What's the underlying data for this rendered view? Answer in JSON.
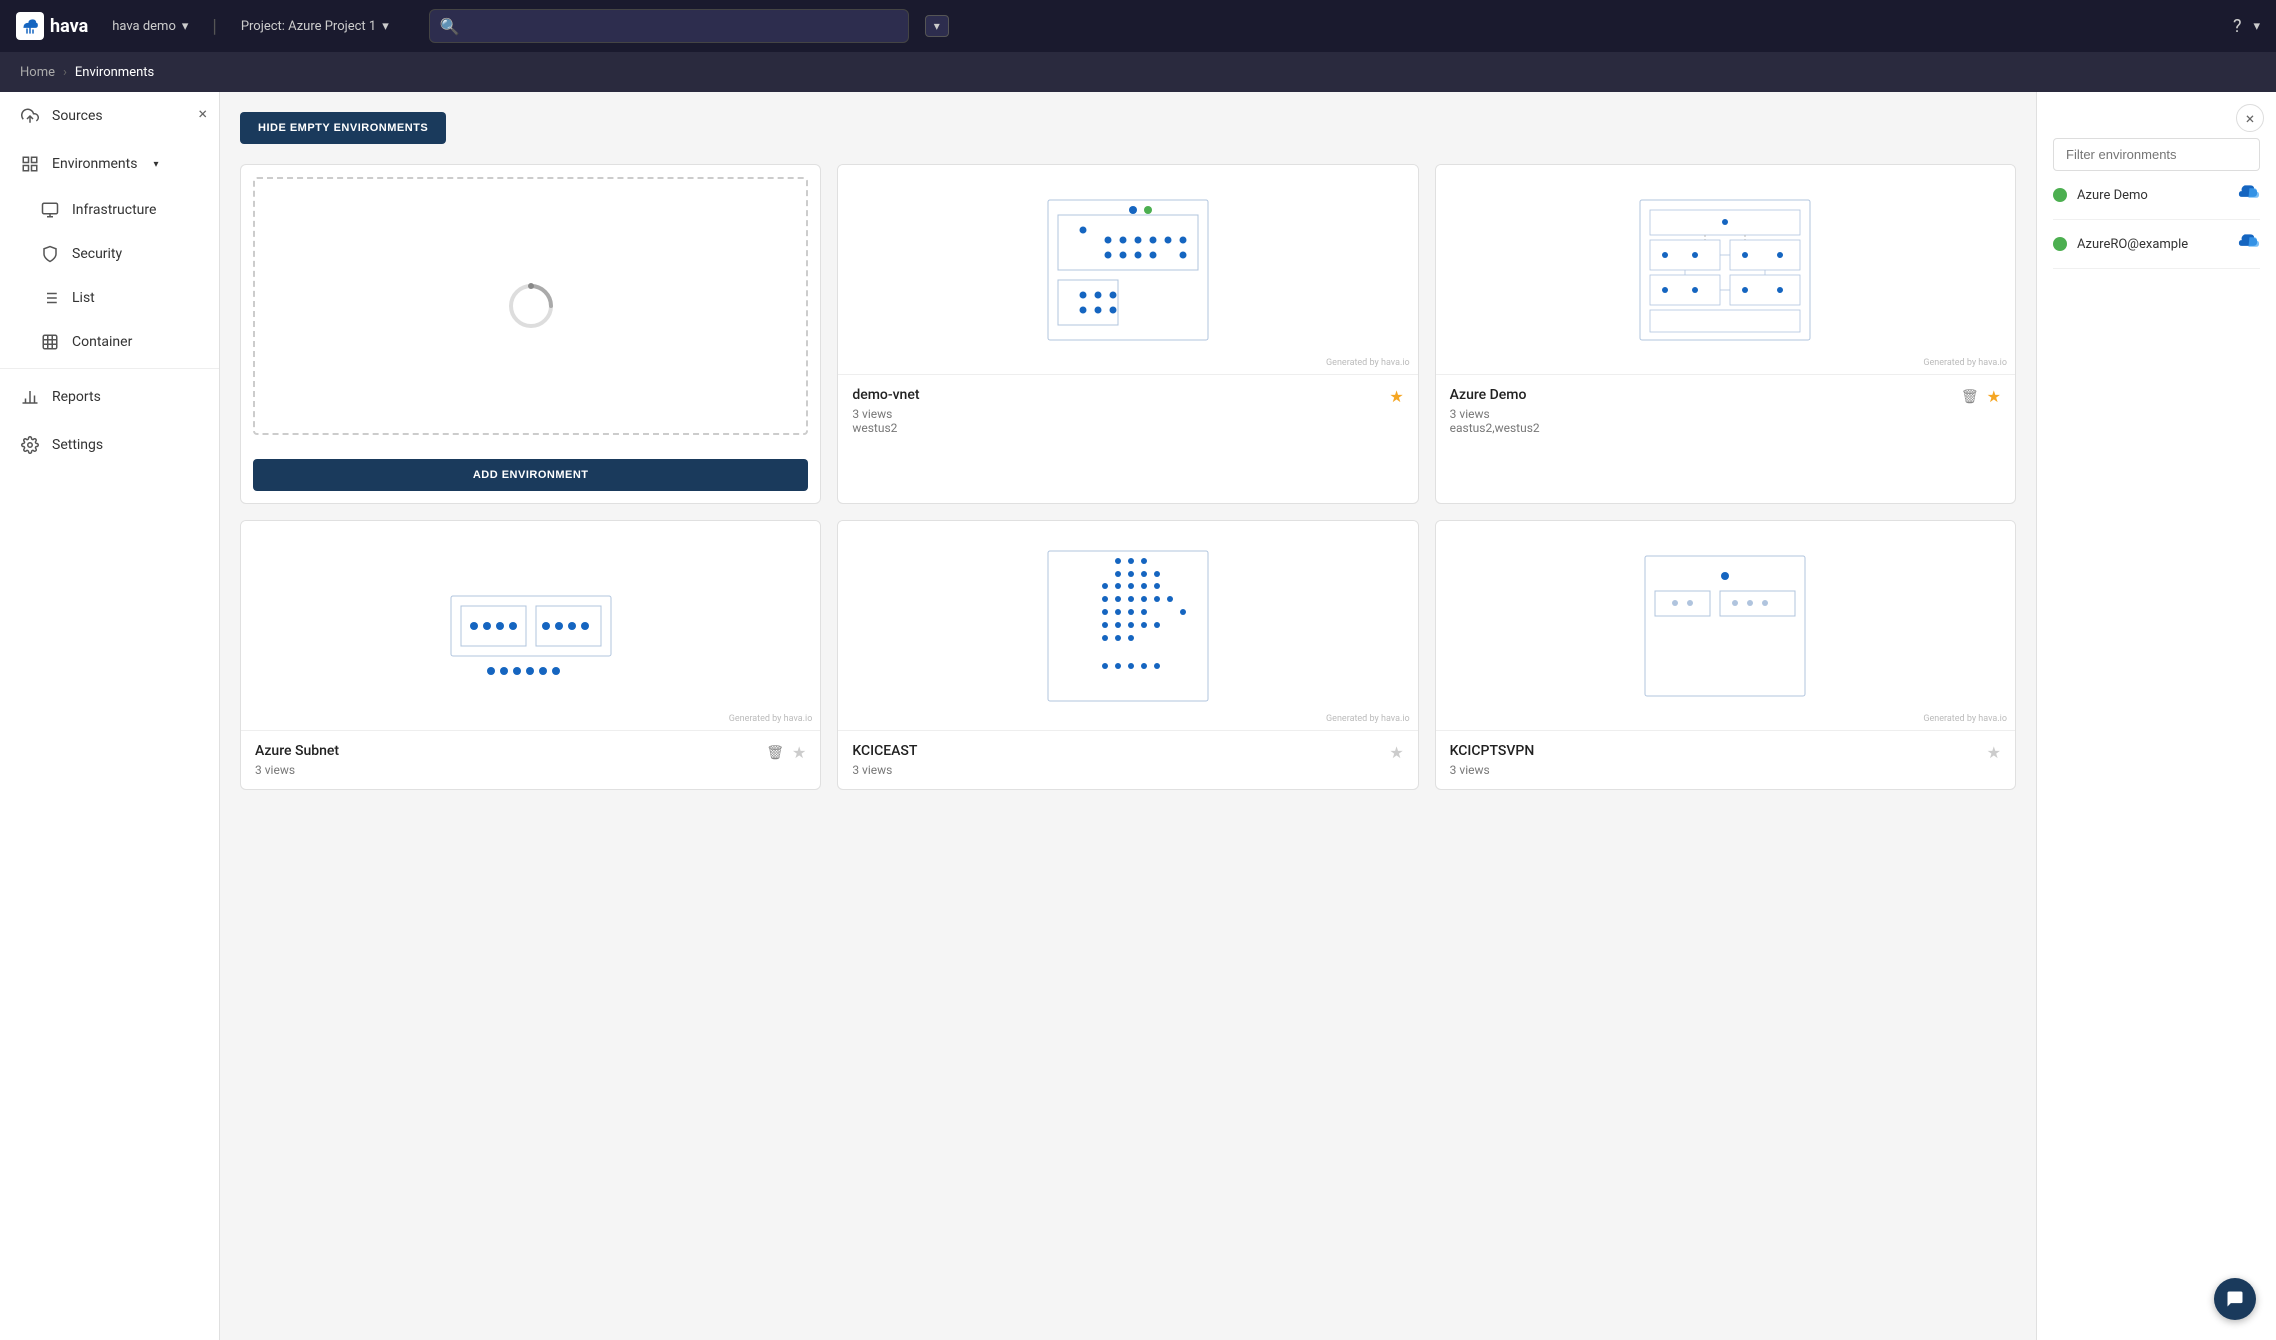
{
  "app": {
    "logo_text": "hava",
    "logo_icon": "cloud-upload"
  },
  "top_nav": {
    "workspace": "hava demo",
    "project": "Project: Azure Project 1",
    "search_placeholder": "",
    "help_icon": "?",
    "user_dropdown": "▾"
  },
  "breadcrumb": {
    "home_label": "Home",
    "separator": "›",
    "current": "Environments"
  },
  "sidebar": {
    "close_label": "×",
    "items": [
      {
        "id": "sources",
        "label": "Sources",
        "icon": "cloud-upload"
      },
      {
        "id": "environments",
        "label": "Environments",
        "icon": "grid",
        "has_chevron": true
      },
      {
        "id": "infrastructure",
        "label": "Infrastructure",
        "icon": "monitor",
        "sub": true
      },
      {
        "id": "security",
        "label": "Security",
        "icon": "shield",
        "sub": true
      },
      {
        "id": "list",
        "label": "List",
        "icon": "list",
        "sub": true
      },
      {
        "id": "container",
        "label": "Container",
        "icon": "table",
        "sub": true
      },
      {
        "id": "reports",
        "label": "Reports",
        "icon": "bar-chart"
      },
      {
        "id": "settings",
        "label": "Settings",
        "icon": "gear"
      }
    ]
  },
  "main": {
    "hide_empty_btn": "HIDE EMPTY ENVIRONMENTS",
    "add_environment_btn": "ADD ENVIRONMENT"
  },
  "environments": [
    {
      "id": "add-new",
      "type": "add",
      "name": "",
      "views": "",
      "region": ""
    },
    {
      "id": "demo-vnet",
      "type": "env",
      "name": "demo-vnet",
      "views": "3 views",
      "region": "westus2",
      "starred": true,
      "generated_by": "Generated by hava.io"
    },
    {
      "id": "azure-demo",
      "type": "env",
      "name": "Azure Demo",
      "views": "3 views",
      "region": "eastus2,westus2",
      "starred": true,
      "has_trash": true,
      "generated_by": "Generated by hava.io"
    },
    {
      "id": "azure-subnet",
      "type": "env",
      "name": "Azure Subnet",
      "views": "3 views",
      "region": "",
      "starred": false,
      "has_trash": true,
      "generated_by": "Generated by hava.io"
    },
    {
      "id": "kciceast",
      "type": "env",
      "name": "KCICEAST",
      "views": "3 views",
      "region": "",
      "starred": false,
      "generated_by": "Generated by hava.io"
    },
    {
      "id": "kcicptsvpn",
      "type": "env",
      "name": "KCICPTSVPN",
      "views": "3 views",
      "region": "",
      "starred": false,
      "generated_by": "Generated by hava.io"
    }
  ],
  "right_panel": {
    "close_label": "×",
    "filter_placeholder": "Filter environments",
    "sources": [
      {
        "id": "azure-demo",
        "name": "Azure Demo",
        "status": "active",
        "cloud": "azure"
      },
      {
        "id": "azureroexample",
        "name": "AzureRO@example",
        "status": "active",
        "cloud": "azure"
      }
    ]
  }
}
